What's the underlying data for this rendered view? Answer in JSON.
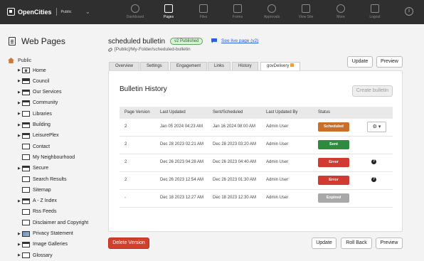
{
  "topnav": {
    "brand": "OpenCities",
    "site": "Public",
    "items": [
      {
        "label": "Dashboard",
        "icon": "dashboard-icon",
        "active": false
      },
      {
        "label": "Pages",
        "icon": "pages-icon",
        "active": true
      },
      {
        "label": "Files",
        "icon": "files-icon",
        "active": false
      },
      {
        "label": "Forms",
        "icon": "forms-icon",
        "active": false
      },
      {
        "label": "Approvals",
        "icon": "approvals-icon",
        "active": false
      },
      {
        "label": "View Site",
        "icon": "view-site-icon",
        "active": false
      },
      {
        "label": "More",
        "icon": "more-icon",
        "active": false
      },
      {
        "label": "Logout",
        "icon": "logout-icon",
        "active": false
      }
    ],
    "info_icon": "i"
  },
  "sidebar": {
    "title": "Web Pages",
    "root": "Public",
    "items": [
      "Home",
      "Council",
      "Our Services",
      "Community",
      "Libraries",
      "Building",
      "LeisurePlex",
      "Contact",
      "My Neighbourhood",
      "Secure",
      "Search Results",
      "Sitemap",
      "A - Z Index",
      "Rss Feeds",
      "Disclaimer and Copyright",
      "Privacy Statement",
      "Image Galleries",
      "Glossary"
    ]
  },
  "page": {
    "title": "scheduled bulletin",
    "badge": "v2 Published",
    "live_link": "See live page (v2)",
    "path": "[Public]/My-Folder/scheduled-bulletin"
  },
  "buttons": {
    "update": "Update",
    "preview": "Preview",
    "create_bulletin": "Create bulletin",
    "delete_version": "Delete Version",
    "roll_back": "Roll Back"
  },
  "tabs": [
    "Overview",
    "Settings",
    "Engagement",
    "Links",
    "History",
    "govDelivery"
  ],
  "history": {
    "title": "Bulletin History",
    "columns": [
      "Page Version",
      "Last Updated",
      "Sent/Scheduled",
      "Last Updated By",
      "Status"
    ],
    "rows": [
      {
        "version": "2",
        "updated": "Jan 05 2024 04:23 AM",
        "sent": "Jan 16 2024 08:00 AM",
        "by": "Admin User",
        "status": "Scheduled",
        "color": "#c8702a",
        "action": "gear"
      },
      {
        "version": "2",
        "updated": "Dec 28 2023 02:21 AM",
        "sent": "Dec 28 2023 03:20 AM",
        "by": "Admin User",
        "status": "Sent",
        "color": "#2e8a3e",
        "action": ""
      },
      {
        "version": "2",
        "updated": "Dec 26 2023 04:28 AM",
        "sent": "Dec 26 2023 04:40 AM",
        "by": "Admin User",
        "status": "Error",
        "color": "#d03a30",
        "action": "help"
      },
      {
        "version": "2",
        "updated": "Dec 26 2023 12:54 AM",
        "sent": "Dec 26 2023 01:30 AM",
        "by": "Admin User",
        "status": "Error",
        "color": "#d03a30",
        "action": "help"
      },
      {
        "version": "-",
        "updated": "Dec 18 2023 12:27 AM",
        "sent": "Dec 18 2023 12:30 AM",
        "by": "Admin User",
        "status": "Expired",
        "color": "#a8a8a8",
        "action": ""
      }
    ]
  },
  "gear_label": "⚙ ▾",
  "help_label": "?"
}
